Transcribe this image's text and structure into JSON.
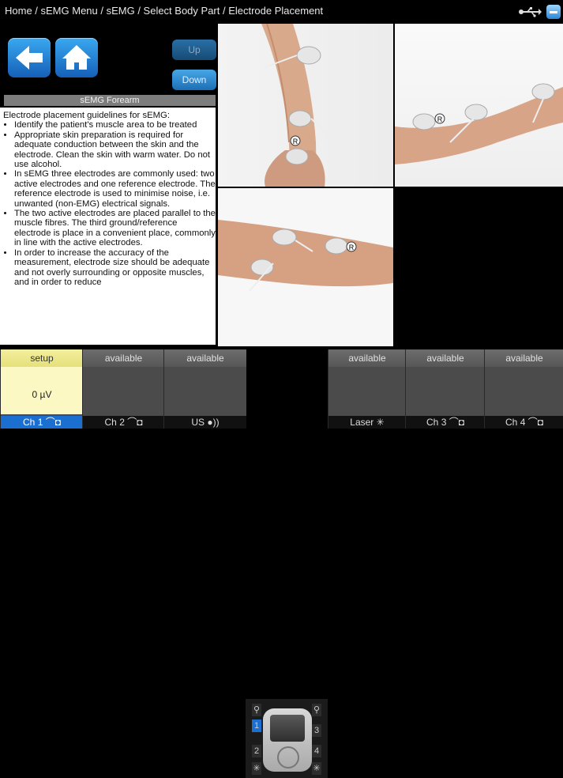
{
  "breadcrumb": "Home / sEMG Menu / sEMG / Select Body Part / Electrode Placement",
  "nav": {
    "up_label": "Up",
    "down_label": "Down"
  },
  "panel_title": "sEMG Forearm",
  "guide": {
    "intro": "Electrode placement guidelines for sEMG:",
    "items": [
      "Identify the patient's muscle area to be treated",
      "Appropriate skin preparation is required for adequate conduction between the skin and the electrode. Clean the skin with warm water. Do not use alcohol.",
      "In sEMG three electrodes are commonly used: two active electrodes and one reference electrode. The reference electrode is used to minimise noise, i.e. unwanted (non-EMG) electrical signals.",
      "The two active electrodes are placed parallel to the muscle fibres. The third ground/reference electrode is place in a convenient place, commonly in line with the active electrodes.",
      "In order to increase the accuracy of the measurement, electrode size should be adequate and not overly surrounding or opposite muscles, and in order to reduce"
    ]
  },
  "electrode_marker": "R",
  "channels": [
    {
      "status": "setup",
      "value": "0 µV",
      "label": "Ch 1",
      "icon": "electrode-icon"
    },
    {
      "status": "available",
      "value": "",
      "label": "Ch 2",
      "icon": "electrode-icon"
    },
    {
      "status": "available",
      "value": "",
      "label": "US",
      "icon": "ultrasound-icon"
    },
    {
      "status": "available",
      "value": "",
      "label": "Laser",
      "icon": "laser-icon"
    },
    {
      "status": "available",
      "value": "",
      "label": "Ch 3",
      "icon": "electrode-icon"
    },
    {
      "status": "available",
      "value": "",
      "label": "Ch 4",
      "icon": "electrode-icon"
    }
  ],
  "device": {
    "left_slots": [
      "1",
      "2"
    ],
    "right_slots": [
      "3",
      "4"
    ]
  }
}
